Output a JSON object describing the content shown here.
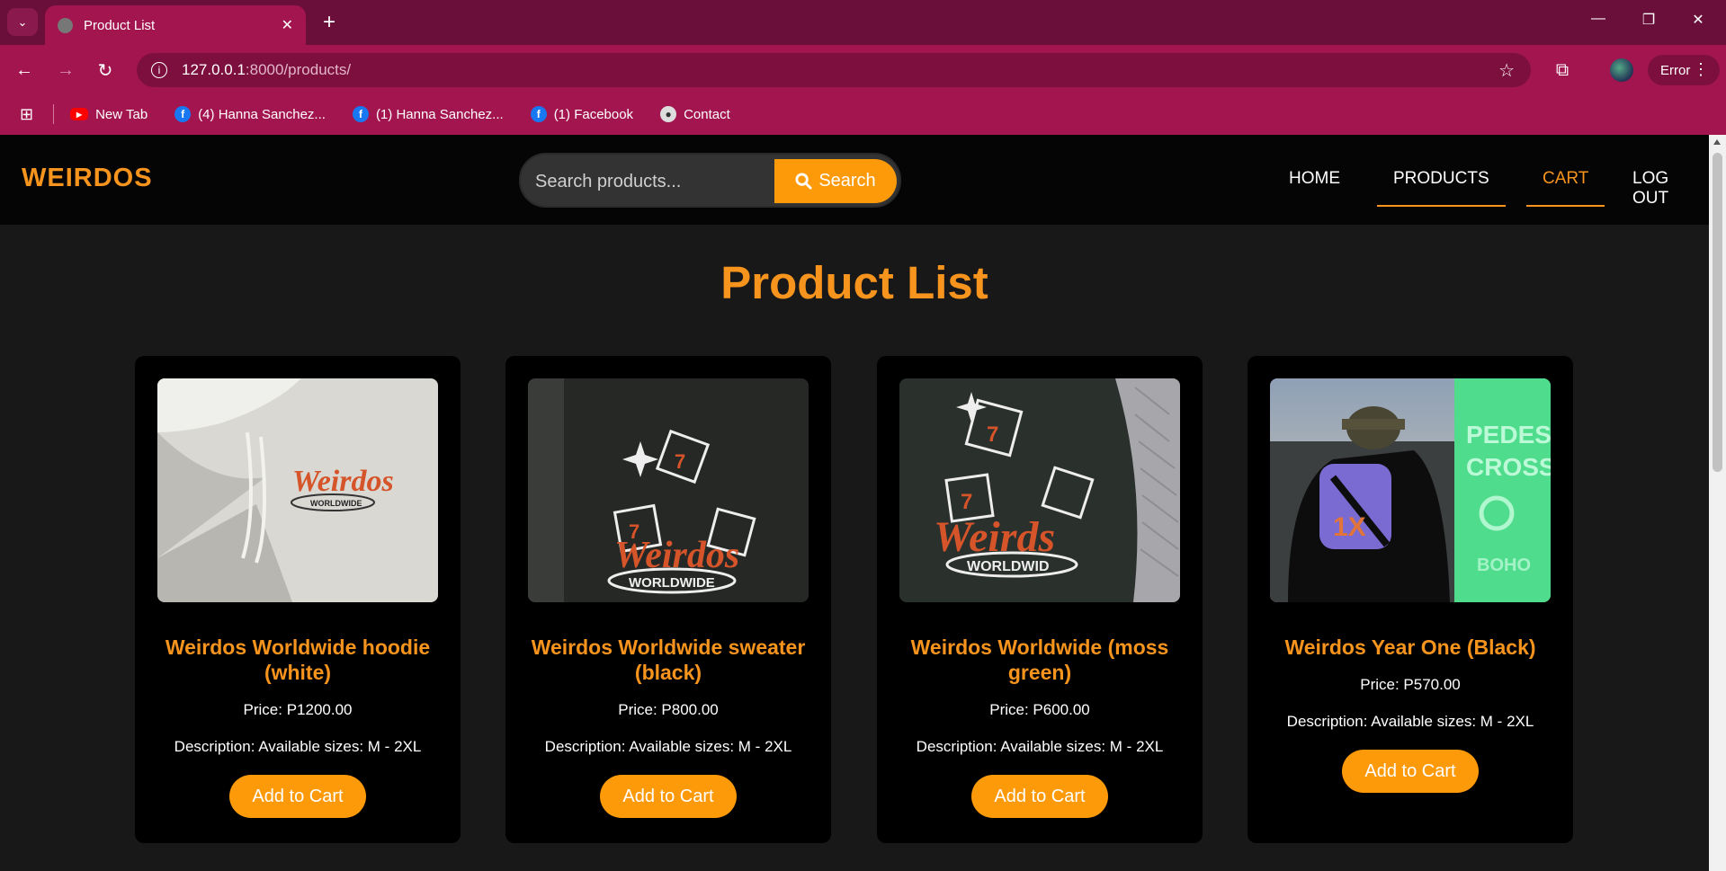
{
  "browser": {
    "tab_title": "Product List",
    "url_host": "127.0.0.1",
    "url_path": ":8000/products/",
    "profile_status": "Error",
    "bookmarks": [
      {
        "label": "New Tab",
        "icon": "youtube-icon"
      },
      {
        "label": "(4) Hanna Sanchez...",
        "icon": "facebook-icon"
      },
      {
        "label": "(1) Hanna Sanchez...",
        "icon": "facebook-icon"
      },
      {
        "label": "(1) Facebook",
        "icon": "facebook-icon"
      },
      {
        "label": "Contact",
        "icon": "globe-icon"
      }
    ]
  },
  "site": {
    "logo": "WEIRDOS",
    "search_placeholder": "Search products...",
    "search_button": "Search",
    "nav": [
      "HOME",
      "PRODUCTS",
      "CART",
      "LOG OUT"
    ],
    "accent_color": "#f7941d",
    "button_color": "#fd9a0a"
  },
  "page_title": "Product List",
  "products": [
    {
      "name": "Weirdos Worldwide hoodie (white)",
      "price": "Price: P1200.00",
      "description": "Description: Available sizes: M - 2XL",
      "button": "Add to Cart"
    },
    {
      "name": "Weirdos Worldwide sweater (black)",
      "price": "Price: P800.00",
      "description": "Description: Available sizes: M - 2XL",
      "button": "Add to Cart"
    },
    {
      "name": "Weirdos Worldwide (moss green)",
      "price": "Price: P600.00",
      "description": "Description: Available sizes: M - 2XL",
      "button": "Add to Cart"
    },
    {
      "name": "Weirdos Year One (Black)",
      "price": "Price: P570.00",
      "description": "Description: Available sizes: M - 2XL",
      "button": "Add to Cart"
    }
  ]
}
